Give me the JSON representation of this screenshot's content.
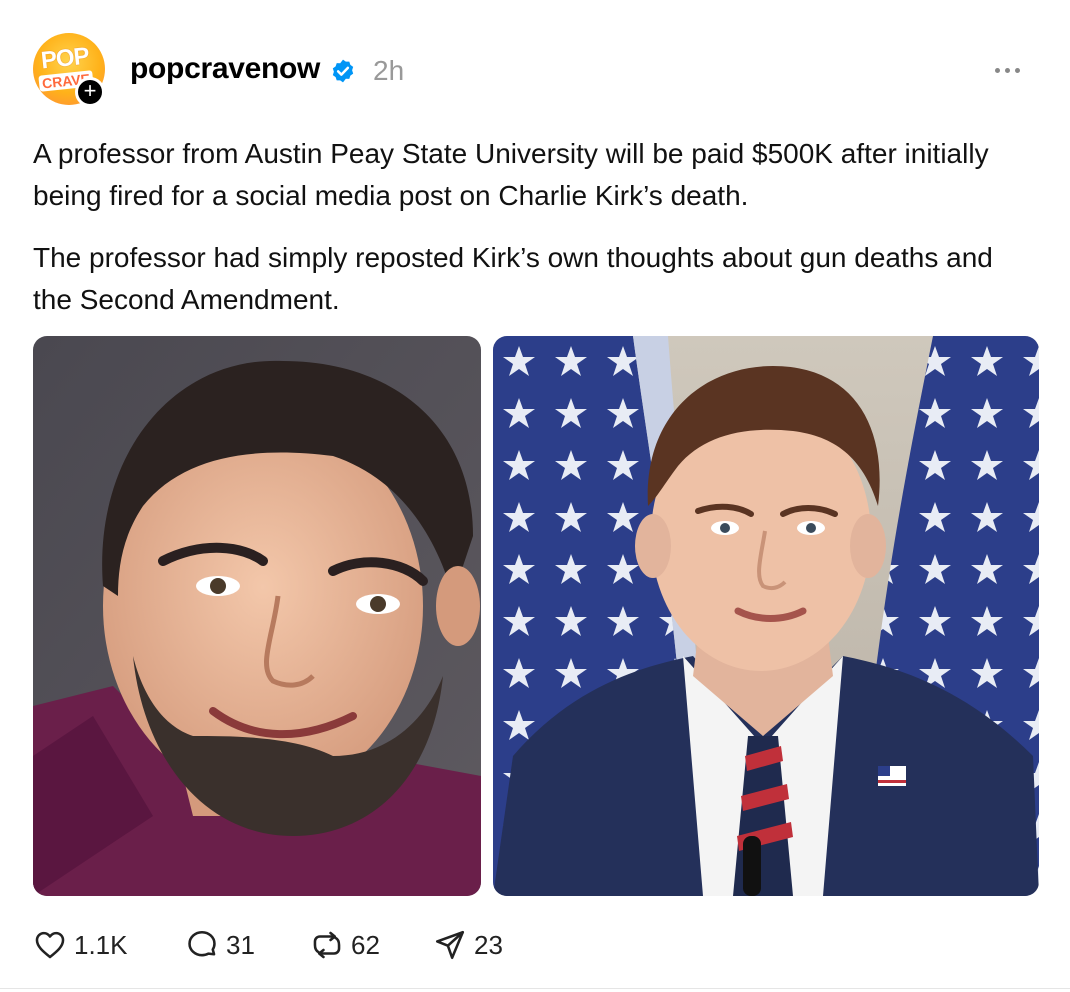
{
  "post": {
    "avatar": {
      "text_top": "POP",
      "text_bottom": "CRAVE",
      "follow_icon": "plus-icon"
    },
    "username": "popcravenow",
    "verified_icon": "verified-badge-icon",
    "time": "2h",
    "more_icon": "more-horizontal-icon",
    "paragraphs": [
      "A professor from Austin Peay State University will be paid $500K after initially being fired for a social media post on Charlie Kirk’s death.",
      "The professor had simply reposted Kirk’s own thoughts about gun deaths and the Second Amendment."
    ],
    "images": [
      {
        "subject": "smiling man with beard in purple shirt"
      },
      {
        "subject": "man in suit at podium with American flags"
      }
    ],
    "actions": [
      {
        "icon": "heart-icon",
        "count": "1.1K"
      },
      {
        "icon": "comment-icon",
        "count": "31"
      },
      {
        "icon": "repost-icon",
        "count": "62"
      },
      {
        "icon": "share-icon",
        "count": "23"
      }
    ],
    "colors": {
      "verified": "#0095f6",
      "muted": "#999999"
    }
  }
}
